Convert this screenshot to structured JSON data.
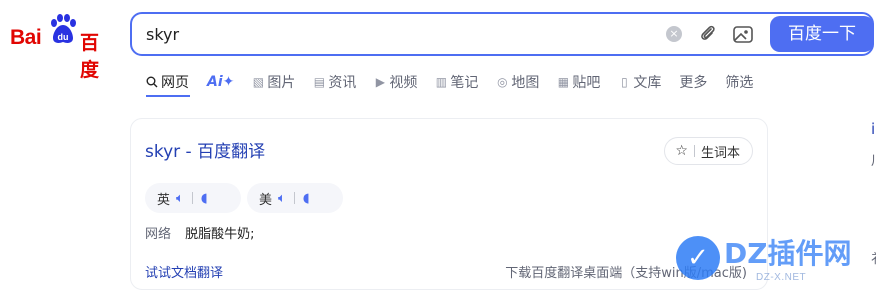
{
  "logo": {
    "bai": "Bai",
    "paw_text": "du",
    "cn": "百度"
  },
  "search": {
    "value": "skyr",
    "clear": "×",
    "button_label": "百度一下"
  },
  "tabs": [
    {
      "label": "网页",
      "icon": "search-icon"
    },
    {
      "label": "Ai✦",
      "icon": ""
    },
    {
      "label": "图片",
      "icon": "image-icon"
    },
    {
      "label": "资讯",
      "icon": "news-icon"
    },
    {
      "label": "视频",
      "icon": "video-icon"
    },
    {
      "label": "笔记",
      "icon": "note-icon"
    },
    {
      "label": "地图",
      "icon": "map-icon"
    },
    {
      "label": "贴吧",
      "icon": "tieba-icon"
    },
    {
      "label": "文库",
      "icon": "doc-icon"
    },
    {
      "label": "更多",
      "icon": ""
    },
    {
      "label": "筛选",
      "icon": ""
    }
  ],
  "card": {
    "title": "skyr - 百度翻译",
    "vocab_label": "生词本",
    "pron_uk": "英",
    "pron_us": "美",
    "def_label": "网络",
    "def_value": "脱脂酸牛奶;",
    "try_link": "试试文档翻译",
    "download_link": "下载百度翻译桌面端（支持win版/mac版)"
  },
  "right_column": {
    "c1": "i",
    "c2": "川",
    "c3": "衤"
  },
  "watermark": {
    "badge": "✓",
    "text": "DZ插件网",
    "sub": "DZ-X.NET"
  },
  "colors": {
    "accent": "#4e6ef2",
    "brand_red": "#e10602",
    "link": "#2440b3"
  }
}
